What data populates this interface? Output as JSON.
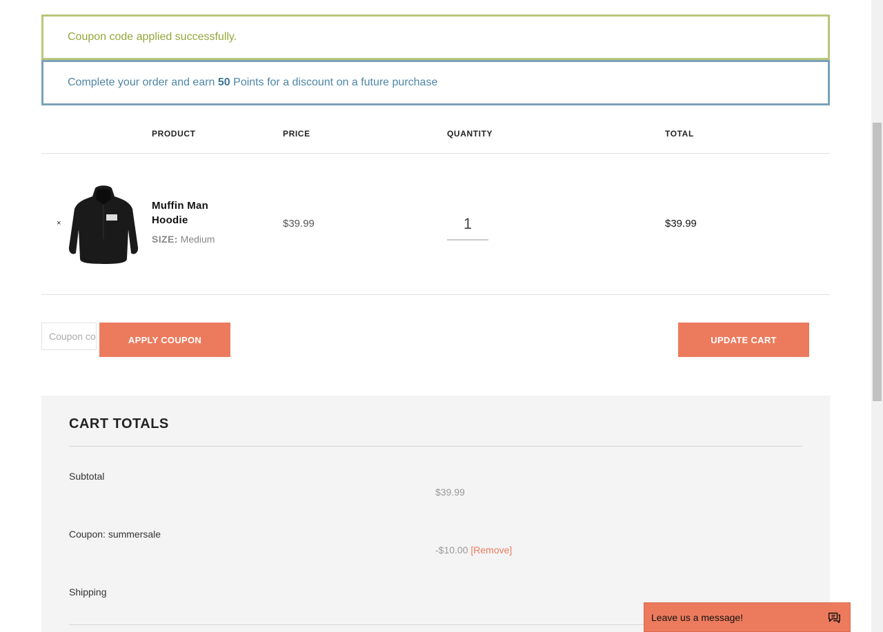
{
  "notices": {
    "success": "Coupon code applied successfully.",
    "info_prefix": "Complete your order and earn",
    "info_points": "50",
    "info_suffix": "Points for a discount on a future purchase"
  },
  "table": {
    "headers": {
      "product": "PRODUCT",
      "price": "PRICE",
      "quantity": "QUANTITY",
      "total": "TOTAL"
    }
  },
  "cart_item": {
    "remove_symbol": "×",
    "name": "Muffin Man Hoodie",
    "size_label": "SIZE:",
    "size_value": "Medium",
    "price": "$39.99",
    "quantity": "1",
    "total": "$39.99"
  },
  "actions": {
    "coupon_placeholder": "Coupon code",
    "apply_coupon": "APPLY COUPON",
    "update_cart": "UPDATE CART"
  },
  "totals": {
    "title": "CART TOTALS",
    "subtotal_label": "Subtotal",
    "subtotal_value": "$39.99",
    "coupon_label": "Coupon: summersale",
    "coupon_value": "-$10.00",
    "coupon_remove": "[Remove]",
    "shipping_label": "Shipping"
  },
  "chat": {
    "label": "Leave us a message!"
  },
  "colors": {
    "accent": "#ec7b5e",
    "success_border": "#b9c77a",
    "info_border": "#7aa1b8"
  }
}
